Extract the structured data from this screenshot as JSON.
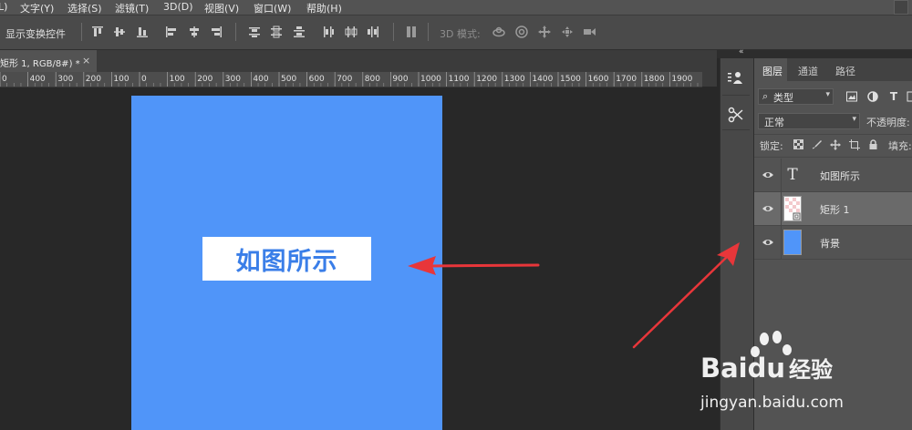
{
  "menu": {
    "items": [
      "L)",
      "文字(Y)",
      "选择(S)",
      "滤镜(T)",
      "3D(D)",
      "视图(V)",
      "窗口(W)",
      "帮助(H)"
    ]
  },
  "options_bar": {
    "show_transform_label": "显示变换控件",
    "mode_3d_label": "3D 模式:",
    "align_icons": [
      "align-top-icon",
      "align-vcenter-icon",
      "align-bottom-icon",
      "align-left-icon",
      "align-hcenter-icon",
      "align-right-icon"
    ],
    "distribute_icons": [
      "distribute-top-icon",
      "distribute-vcenter-icon",
      "distribute-bottom-icon",
      "distribute-left-icon",
      "distribute-hcenter-icon",
      "distribute-right-icon"
    ],
    "auto_align_icon": "auto-align-icon",
    "mode_3d_icons": [
      "orbit-3d-icon",
      "roll-3d-icon",
      "pan-3d-icon",
      "slide-3d-icon",
      "scale-3d-icon"
    ]
  },
  "document": {
    "tab_title": "矩形 1, RGB/8#) *",
    "tab_close": "×",
    "canvas_color": "#5095f9",
    "text_box_label": "如图所示",
    "text_color": "#3a7ee8"
  },
  "ruler": {
    "labels": [
      "0",
      "400",
      "300",
      "200",
      "100",
      "0",
      "100",
      "200",
      "300",
      "400",
      "500",
      "600",
      "700",
      "800",
      "900",
      "1000",
      "1100",
      "1200",
      "1300",
      "1400",
      "1500",
      "1600",
      "1700",
      "1800",
      "1900"
    ]
  },
  "panel": {
    "collapse_glyph": "«",
    "strip_icons": [
      "paragraph-style-icon",
      "tool-presets-icon"
    ],
    "tabs": [
      "图层",
      "通道",
      "路径"
    ],
    "filter_label": "类型",
    "filter_icons": [
      "pixel-filter-icon",
      "adjustment-filter-icon",
      "type-filter-icon"
    ],
    "blend_mode": "正常",
    "opacity_label": "不透明度:",
    "lock_label": "锁定:",
    "fill_label": "填充:",
    "lock_icons": [
      "lock-transparent-icon",
      "lock-paint-icon",
      "lock-move-icon",
      "lock-artboard-icon",
      "lock-all-icon"
    ],
    "layers": [
      {
        "name": "如图所示",
        "type": "text",
        "selected": false
      },
      {
        "name": "矩形 1",
        "type": "shape",
        "selected": true
      },
      {
        "name": "背景",
        "type": "fill",
        "selected": false,
        "swatch": "#5095f9"
      }
    ]
  },
  "watermark": {
    "brand_text": "Bai",
    "brand_text_tail": "du",
    "brand_cn": "经验",
    "url": "jingyan.baidu.com"
  },
  "colors": {
    "arrow": "#e8363a",
    "panel_bg": "#535353",
    "selected_layer": "#6a6a6a"
  }
}
